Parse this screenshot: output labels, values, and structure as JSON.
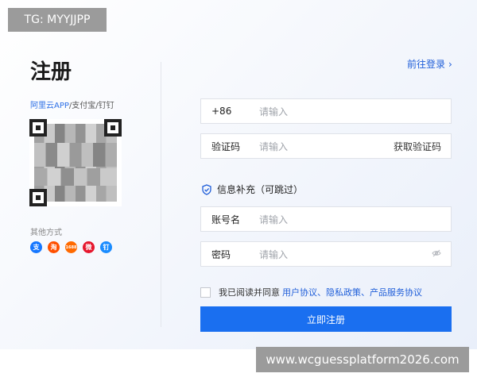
{
  "watermark": {
    "top": "TG: MYYJJPP",
    "bottom": "www.wcguessplatform2026.com"
  },
  "page": {
    "title": "注册",
    "login_link": "前往登录",
    "login_chevron": "›"
  },
  "qr": {
    "scan_apps_blue": "阿里云APP",
    "scan_apps_rest": "/支付宝/钉钉"
  },
  "other_methods": {
    "label": "其他方式",
    "icons": [
      {
        "name": "alipay-icon",
        "glyph": "支",
        "color": "#1677ff"
      },
      {
        "name": "taobao-icon",
        "glyph": "淘",
        "color": "#ff5000"
      },
      {
        "name": "1688-icon",
        "glyph": "1688",
        "color": "#ff6a00"
      },
      {
        "name": "weibo-icon",
        "glyph": "微",
        "color": "#e6162d"
      },
      {
        "name": "dingtalk-icon",
        "glyph": "钉",
        "color": "#1a8cff"
      }
    ]
  },
  "form": {
    "phone": {
      "prefix": "+86",
      "placeholder": "请输入"
    },
    "code": {
      "label": "验证码",
      "placeholder": "请输入",
      "action": "获取验证码"
    },
    "info_title": "信息补充（可跳过）",
    "account": {
      "label": "账号名",
      "placeholder": "请输入"
    },
    "password": {
      "label": "密码",
      "placeholder": "请输入"
    },
    "agree": {
      "prefix": "我已阅读并同意",
      "links": "用户协议、隐私政策、产品服务协议"
    },
    "submit": "立即注册"
  },
  "colors": {
    "accent": "#1a6ff0",
    "link": "#1f5ed9"
  }
}
